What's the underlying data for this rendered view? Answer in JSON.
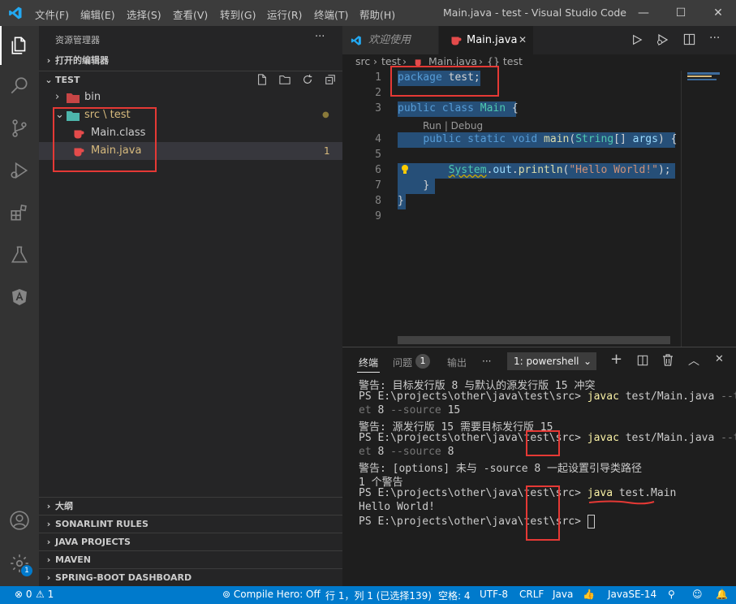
{
  "titlebar": {
    "menus": [
      "文件(F)",
      "编辑(E)",
      "选择(S)",
      "查看(V)",
      "转到(G)",
      "运行(R)",
      "终端(T)",
      "帮助(H)"
    ],
    "title": "Main.java - test - Visual Studio Code",
    "minimize": "—",
    "maximize": "☐",
    "close": "✕"
  },
  "activity_icons": [
    "explorer-icon",
    "search-icon",
    "source-control-icon",
    "run-debug-icon",
    "extensions-icon",
    "testing-icon",
    "angular-icon",
    "account-icon",
    "settings-gear-icon"
  ],
  "settings_badge": "1",
  "sidebar": {
    "title": "资源管理器",
    "more": "···",
    "open_editors": "打开的编辑器",
    "workspace": "TEST",
    "tree": [
      {
        "label": "bin",
        "kind": "folder",
        "expanded": false
      },
      {
        "label": "src \\ test",
        "kind": "folder",
        "expanded": true,
        "badge": "●"
      },
      {
        "label": "Main.class",
        "kind": "file"
      },
      {
        "label": "Main.java",
        "kind": "file",
        "badge": "1",
        "selected": true
      }
    ],
    "bottom_sections": [
      "大纲",
      "SONARLINT RULES",
      "JAVA PROJECTS",
      "MAVEN",
      "SPRING-BOOT DASHBOARD"
    ]
  },
  "editor": {
    "tabs": [
      {
        "label": "欢迎使用",
        "active": false
      },
      {
        "label": "Main.java",
        "active": true
      }
    ],
    "breadcrumb": [
      "src",
      "test",
      "Main.java",
      "{} test"
    ],
    "codelens": "Run | Debug",
    "line_numbers": [
      "1",
      "2",
      "3",
      "4",
      "5",
      "6",
      "7",
      "8",
      "9"
    ],
    "code": {
      "l1_kw": "package",
      "l1_name": "test;",
      "l3_kw1": "public",
      "l3_kw2": "class",
      "l3_name": "Main",
      "l3_brace": "{",
      "l4_kw1": "public",
      "l4_kw2": "static",
      "l4_kw3": "void",
      "l4_fn": "main",
      "l4_paren": "(",
      "l4_type": "String",
      "l4_arr": "[]",
      "l4_arg": "args",
      "l4_end": ") {",
      "l6_cls": "System",
      "l6_dot1": ".",
      "l6_out": "out",
      "l6_dot2": ".",
      "l6_fn": "println",
      "l6_p1": "(",
      "l6_str": "\"Hello World!\"",
      "l6_p2": ");",
      "l7": "}",
      "l8": "}"
    }
  },
  "panel": {
    "tabs": [
      "终端",
      "问题",
      "输出",
      "···"
    ],
    "problems_count": "1",
    "terminal_select": "1: powershell",
    "lines": [
      {
        "t": "警告: 目标发行版 8 与默认的源发行版 15 冲突"
      },
      {
        "prompt": "PS E:\\projects\\other\\java\\test\\src> ",
        "cmd": "javac",
        "rest": " test/Main.java ",
        "flag": "--targ"
      },
      {
        "flag2": "et",
        "rest2": " 8 ",
        "flag3": "--source",
        "rest3": " 15"
      },
      {
        "t": "警告: 源发行版 15 需要目标发行版 15"
      },
      {
        "prompt": "PS E:\\projects\\other\\java\\test\\src> ",
        "cmd": "javac",
        "rest": " test/Main.java ",
        "flag": "--targ"
      },
      {
        "flag2": "et",
        "rest2": " 8 ",
        "flag3": "--source",
        "rest3": " 8"
      },
      {
        "t": "警告: [options] 未与 -source 8 一起设置引导类路径"
      },
      {
        "t": "1 个警告"
      },
      {
        "prompt": "PS E:\\projects\\other\\java\\test\\src> ",
        "cmd": "java",
        "rest": " test.Main"
      },
      {
        "t": "Hello World!"
      },
      {
        "prompt": "PS E:\\projects\\other\\java\\test\\src> "
      }
    ]
  },
  "statusbar": {
    "errors": "0",
    "warnings": "1",
    "compile_hero": "Compile Hero: Off",
    "position": "行 1，列 1 (已选择139)",
    "spaces": "空格: 4",
    "encoding": "UTF-8",
    "eol": "CRLF",
    "language": "Java",
    "jdk": "JavaSE-14"
  },
  "colors": {
    "accent": "#007acc",
    "annotation_red": "#e53935",
    "java_icon": "#e44b4b"
  }
}
